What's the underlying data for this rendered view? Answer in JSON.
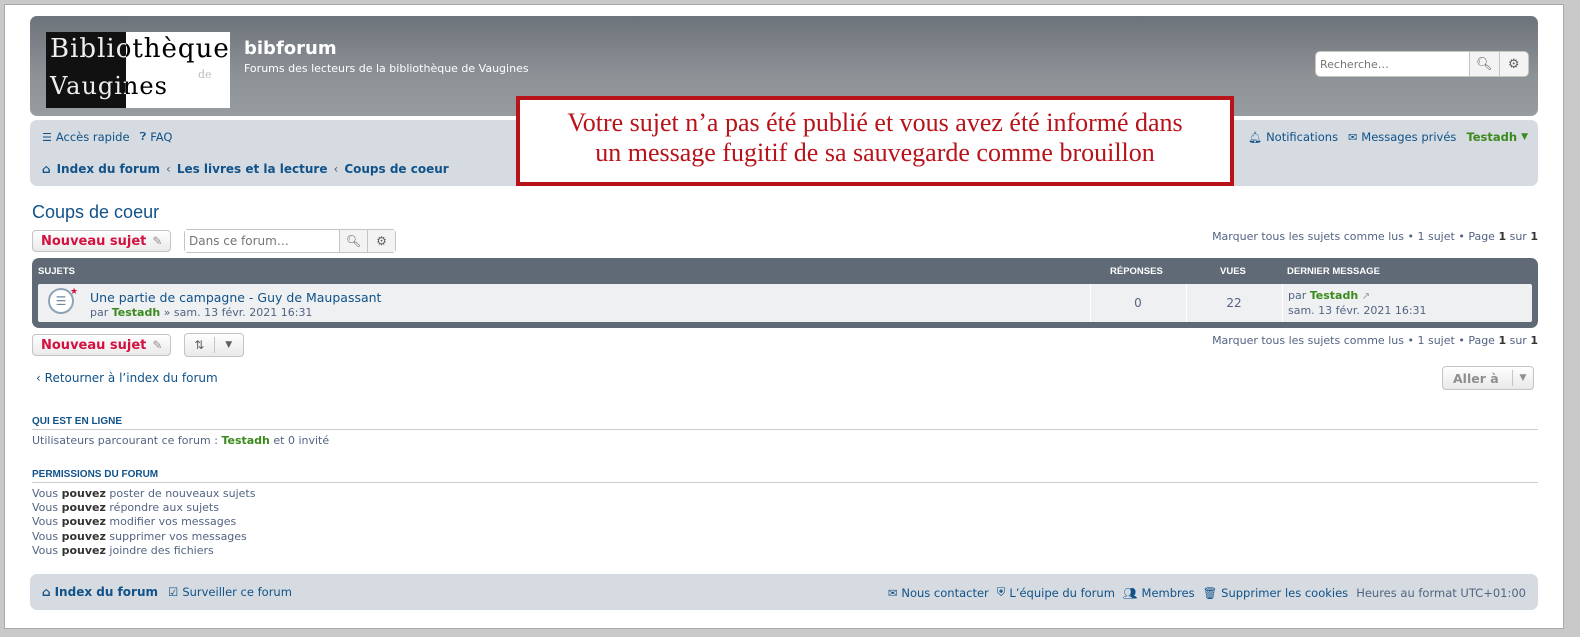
{
  "header": {
    "logo": {
      "line1": "Bibliothèque",
      "line2": "Vaugines",
      "de": "de"
    },
    "site_title": "bibforum",
    "site_desc": "Forums des lecteurs de la bibliothèque de Vaugines",
    "search_placeholder": "Recherche…"
  },
  "nav": {
    "quick": "Accès rapide",
    "faq": "FAQ",
    "notifications": "Notifications",
    "pm": "Messages privés",
    "user": "Testadh",
    "crumbs": [
      "Index du forum",
      "Les livres et la lecture",
      "Coups de coeur"
    ]
  },
  "notice": {
    "line1": "Votre sujet n’a  pas été publié et vous avez été informé dans",
    "line2": "un message fugitif de sa sauvegarde comme brouillon"
  },
  "forum": {
    "title": "Coups de coeur",
    "new_topic": "Nouveau sujet",
    "search_placeholder": "Dans ce forum…",
    "pagination": {
      "mark": "Marquer tous les sujets comme lus",
      "sep": "•",
      "count": "1 sujet",
      "page_label": "Page",
      "page": "1",
      "of": "sur",
      "total": "1"
    },
    "headers": {
      "topics": "SUJETS",
      "replies": "RÉPONSES",
      "views": "VUES",
      "last": "DERNIER MESSAGE"
    },
    "topics": [
      {
        "title": "Une partie de campagne - Guy de Maupassant",
        "by": "par",
        "author": "Testadh",
        "date": "» sam. 13 févr. 2021 16:31",
        "replies": "0",
        "views": "22",
        "last_by": "par",
        "last_author": "Testadh",
        "last_date": "sam. 13 févr. 2021 16:31"
      }
    ],
    "back": "Retourner à l’index du forum",
    "jump": "Aller à"
  },
  "online": {
    "heading": "QUI EST EN LIGNE",
    "prefix": "Utilisateurs parcourant ce forum :",
    "user": "Testadh",
    "suffix": "et 0 invité"
  },
  "permissions": {
    "heading": "PERMISSIONS DU FORUM",
    "word_you": "Vous",
    "word_can": "pouvez",
    "items": [
      "poster de nouveaux sujets",
      "répondre aux sujets",
      "modifier vos messages",
      "supprimer vos messages",
      "joindre des fichiers"
    ]
  },
  "footer": {
    "index": "Index du forum",
    "watch": "Surveiller ce forum",
    "contact": "Nous contacter",
    "team": "L’équipe du forum",
    "members": "Membres",
    "cookies": "Supprimer les cookies",
    "tz": "Heures au format UTC+01:00"
  }
}
